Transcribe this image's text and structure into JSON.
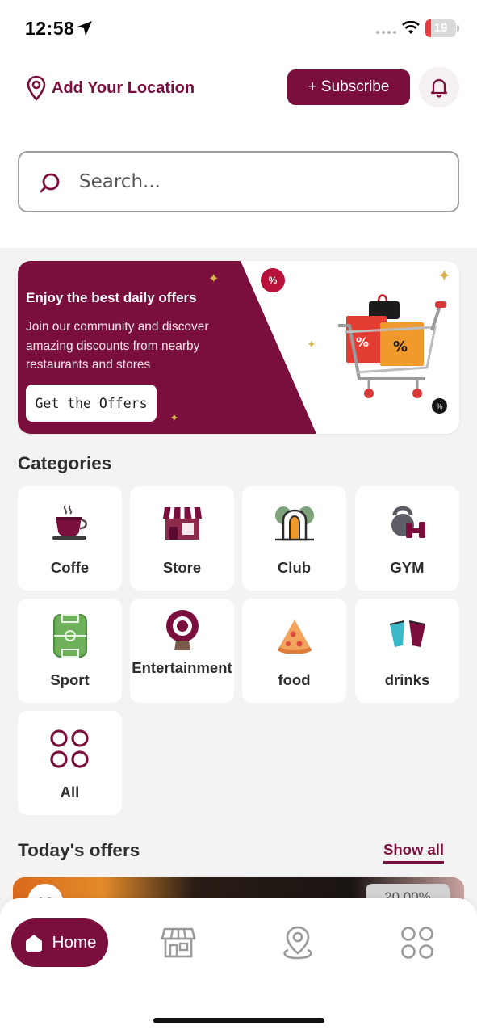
{
  "status_bar": {
    "time": "12:58",
    "battery": "19"
  },
  "header": {
    "location_label": "Add Your Location",
    "subscribe_label": "+ Subscribe"
  },
  "search": {
    "placeholder": "Search..."
  },
  "banner": {
    "title": "Enjoy the best daily offers",
    "description": "Join our community and discover amazing discounts from nearby restaurants and stores",
    "cta_label": "Get the Offers",
    "percent_badge": "%"
  },
  "categories": {
    "title": "Categories",
    "items": [
      {
        "label": "Coffe",
        "icon": "coffee-cup-icon"
      },
      {
        "label": "Store",
        "icon": "store-icon"
      },
      {
        "label": "Club",
        "icon": "club-icon"
      },
      {
        "label": "GYM",
        "icon": "kettlebell-icon"
      },
      {
        "label": "Sport",
        "icon": "football-field-icon"
      },
      {
        "label": "Entertainment",
        "icon": "entertainment-icon"
      },
      {
        "label": "food",
        "icon": "pizza-slice-icon"
      },
      {
        "label": "drinks",
        "icon": "drinks-icon"
      },
      {
        "label": "All",
        "icon": "grid-icon"
      }
    ]
  },
  "offers": {
    "title": "Today's offers",
    "show_all_label": "Show all",
    "first_offer": {
      "logo_text": "AG",
      "discount": "20.00%"
    }
  },
  "bottom_nav": {
    "items": [
      {
        "label": "Home",
        "icon": "home-icon",
        "active": true
      },
      {
        "label": "",
        "icon": "store-icon"
      },
      {
        "label": "",
        "icon": "map-pin-icon"
      },
      {
        "label": "",
        "icon": "grid-icon"
      }
    ]
  },
  "colors": {
    "brand": "#7a0f3e",
    "background": "#f3f3f3"
  }
}
